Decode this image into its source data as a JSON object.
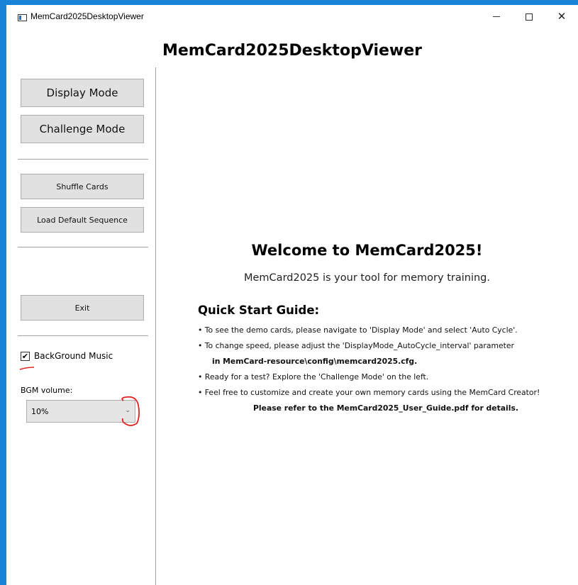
{
  "window": {
    "title": "MemCard2025DesktopViewer",
    "controls": {
      "minimize": "—",
      "maximize": "□",
      "close": "✕"
    }
  },
  "header": {
    "title": "MemCard2025DesktopViewer"
  },
  "sidebar": {
    "buttons": {
      "display_mode": "Display Mode",
      "challenge_mode": "Challenge Mode",
      "shuffle": "Shuffle Cards",
      "load_default": "Load Default Sequence",
      "exit": "Exit"
    },
    "bgm_checkbox": {
      "label": "BackGround Music",
      "checked": true,
      "mark": "✔"
    },
    "volume": {
      "label": "BGM volume:",
      "value": "10%",
      "arrow": "⌄"
    }
  },
  "main": {
    "welcome_title": "Welcome to MemCard2025!",
    "welcome_sub": "MemCard2025 is your tool for memory training.",
    "guide_title": "Quick Start Guide:",
    "guide_lines": [
      "• To see the demo cards, please navigate to 'Display Mode' and select 'Auto Cycle'.",
      "• To change speed, please adjust the 'DisplayMode_AutoCycle_interval' parameter",
      "in MemCard-resource\\config\\memcard2025.cfg.",
      "• Ready for a test? Explore the 'Challenge Mode' on the left.",
      "• Feel free to customize and create your own memory cards using the MemCard Creator!",
      "Please refer to the MemCard2025_User_Guide.pdf for details."
    ]
  },
  "colors": {
    "desktop_accent": "#1883d7",
    "button_bg": "#e1e1e1",
    "annotation_red": "#e2201f"
  }
}
